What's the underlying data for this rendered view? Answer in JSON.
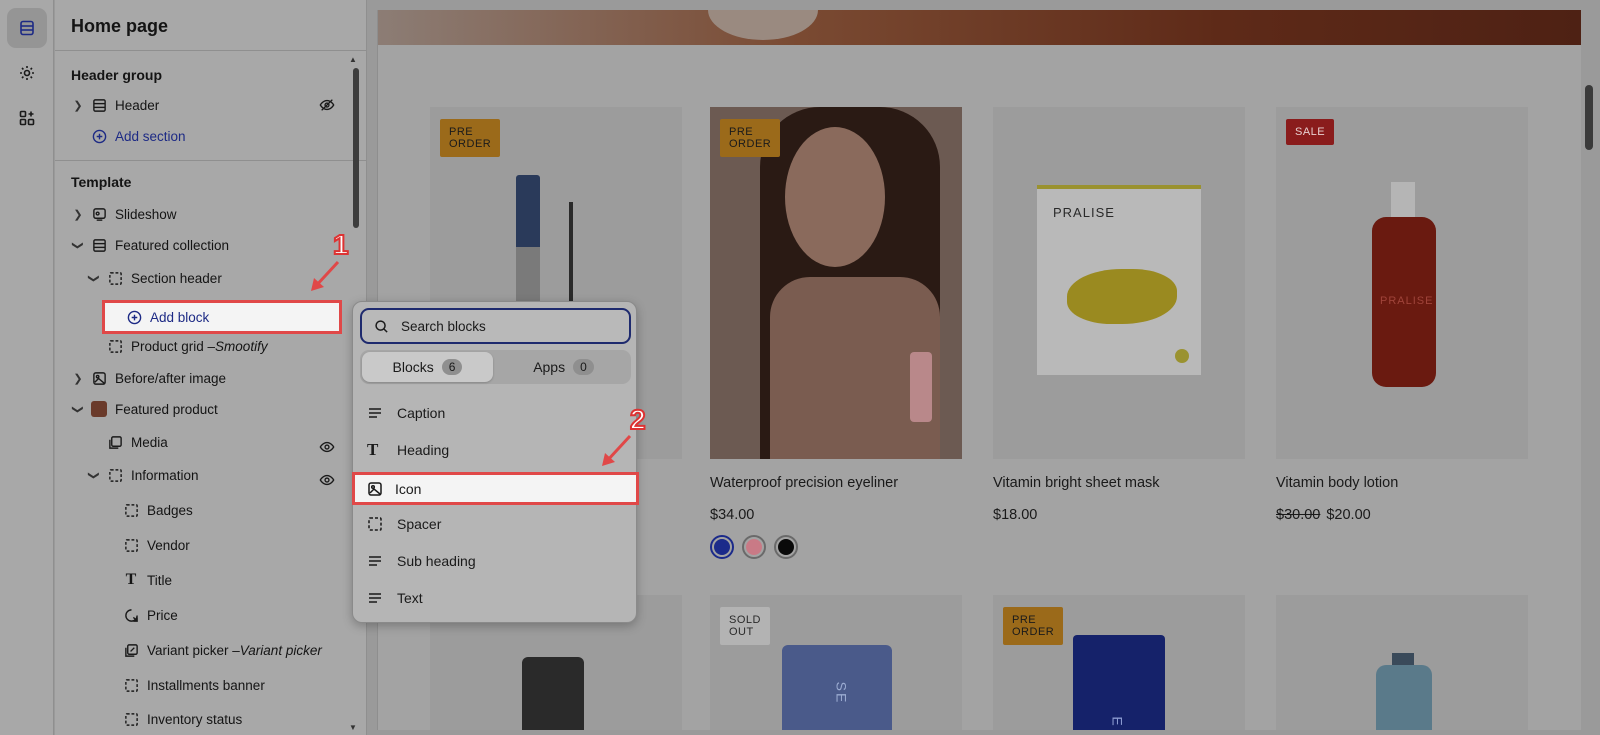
{
  "sidebar": {
    "title": "Home page",
    "header_group": {
      "title": "Header group",
      "items": [
        {
          "label": "Header"
        }
      ],
      "add_section": "Add section"
    },
    "template": {
      "title": "Template",
      "slideshow": "Slideshow",
      "featured_collection": "Featured collection",
      "section_header": "Section header",
      "add_block": "Add block",
      "product_grid": "Product grid – ",
      "product_grid_app": "Smootify",
      "before_after": "Before/after image",
      "featured_product": "Featured product",
      "media": "Media",
      "information": "Information",
      "badges": "Badges",
      "vendor": "Vendor",
      "title_block": "Title",
      "price": "Price",
      "variant_picker": "Variant picker – ",
      "variant_picker_app": "Variant picker",
      "installments": "Installments banner",
      "inventory": "Inventory status"
    }
  },
  "popup": {
    "search_placeholder": "Search blocks",
    "tabs": [
      {
        "label": "Blocks",
        "count": "6"
      },
      {
        "label": "Apps",
        "count": "0"
      }
    ],
    "items": [
      "Caption",
      "Heading",
      "Icon",
      "Spacer",
      "Sub heading",
      "Text"
    ]
  },
  "preview": {
    "products": [
      {
        "badge": "PRE ORDER",
        "title": "",
        "price": ""
      },
      {
        "badge": "PRE ORDER",
        "title": "Waterproof precision eyeliner",
        "price": "$34.00"
      },
      {
        "badge": "",
        "title": "Vitamin bright sheet mask",
        "price": "$18.00",
        "brand": "PRALISE"
      },
      {
        "badge": "SALE",
        "title": "Vitamin body lotion",
        "price_old": "$30.00",
        "price": "$20.00",
        "brand": "PRALISE"
      }
    ],
    "row2_badges": [
      "SOLD OUT",
      "PRE ORDER"
    ],
    "tube_text_1": "SE",
    "tube_text_2": "E"
  },
  "annotations": {
    "step1": "1",
    "step2": "2"
  },
  "colors": {
    "highlight": "#e04848",
    "link": "#1d2a85",
    "swatches": [
      "#1b2a8a",
      "#c97a86",
      "#0a0a0a"
    ]
  }
}
